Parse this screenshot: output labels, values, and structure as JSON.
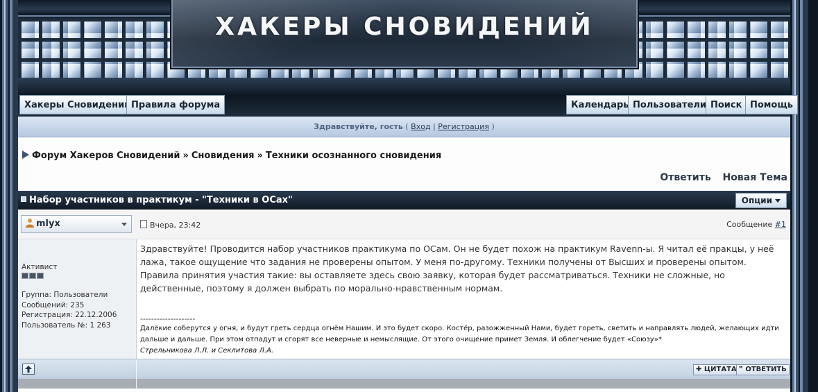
{
  "header": {
    "logo_text": "ХАКЕРЫ СНОВИДЕНИЙ"
  },
  "nav": {
    "left": [
      "Хакеры Сновидений",
      "Правила форума"
    ],
    "right": [
      "Календарь",
      "Пользователи",
      "Поиск",
      "Помощь"
    ]
  },
  "userbar": {
    "greeting": "Здравствуйте, гость",
    "open_paren": "(",
    "login": "Вход",
    "separator": "|",
    "register": "Регистрация",
    "close_paren": ")"
  },
  "breadcrumb": {
    "items": [
      "Форум Хакеров Сновидений",
      "Сновидения",
      "Техники осознанного сновидения"
    ],
    "separator": "»"
  },
  "actions": {
    "reply": "Ответить",
    "new_topic": "Новая Тема"
  },
  "topic": {
    "title": "Набор участников в практикум - \"Техники в ОСах\"",
    "options_label": "Опции"
  },
  "post": {
    "username": "mlyx",
    "date": "Вчера, 23:42",
    "number_label": "Сообщение",
    "number_link": "#1",
    "rank": "Активист",
    "rank_pips": 3,
    "group": "Группа: Пользователи",
    "posts": "Сообщений: 235",
    "registered": "Регистрация: 22.12.2006",
    "user_no": "Пользователь №: 1 263",
    "text": "Здравствуйте! Проводится набор участников практикума по ОСам. Он не будет похож на практикум Ravenn-ы. Я читал её пракцы, у неё лажа, такое ощущение что задания не проверены опытом. У меня по-другому. Техники получены от Высших и проверены опытом. Правила принятия участия такие: вы оставляете здесь свою заявку, которая будет рассматриваться. Техники не сложные, но действенные, поэтому я должен выбрать по морально-нравственным нормам.",
    "signature_separator": "--------------------",
    "signature": "Далёкие соберутся у огня, и будут греть сердца огнём Нашим. И это будет скоро. Костёр, разожженный Нами, будет гореть, светить и направлять людей, желающих идти дальше и дальше. При этом отпадут и сгорят все неверные и немыслящие. От этого очищение примет Земля. И облегчение будет «Союзу»*",
    "signature_author": "Стрельникова Л.Л. и Секлитова Л.А.",
    "quote_label": "ЦИТАТА",
    "reply_label": "ОТВЕТИТЬ"
  },
  "colors": {
    "accent": "#1b2a3c",
    "nav_button": "#c9dbeb",
    "userbar": "#b6c9df"
  }
}
